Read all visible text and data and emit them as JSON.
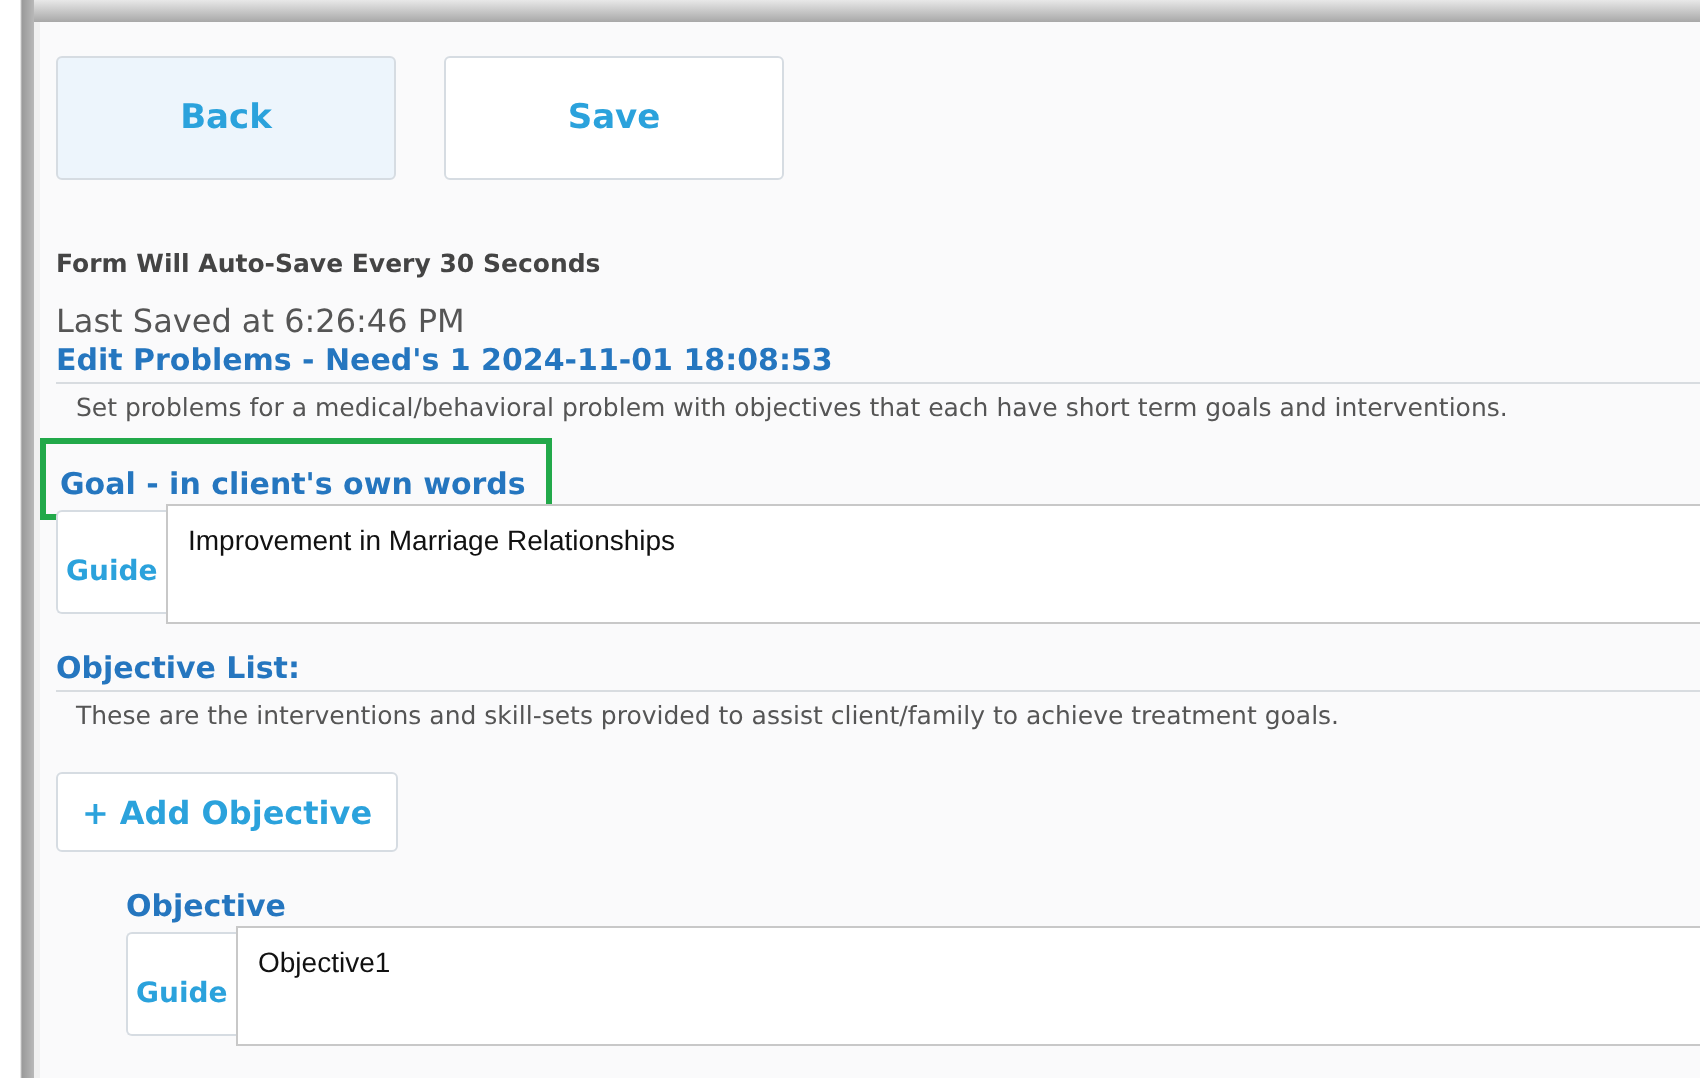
{
  "buttons": [
    {
      "label": "Back",
      "selected": true
    },
    {
      "label": "Save",
      "selected": false
    }
  ],
  "autosave_note": "Form Will Auto-Save Every 30 Seconds",
  "last_saved": "Last Saved at 6:26:46 PM",
  "problem": {
    "title": "Edit Problems - Need's 1 2024-11-01 18:08:53",
    "description": "Set problems for a medical/behavioral problem with objectives that each have short term goals and interventions."
  },
  "goal": {
    "label": "Goal - in client's own words",
    "highlighted": true,
    "guide": "Guide",
    "value": "Improvement in Marriage Relationships"
  },
  "objective_list": {
    "title": "Objective List:",
    "description": "These are the interventions and skill-sets provided to assist client/family to achieve treatment goals.",
    "add_button": "+ Add Objective",
    "objectives": [
      {
        "label": "Objective",
        "guide": "Guide",
        "value": "Objective1"
      }
    ]
  }
}
